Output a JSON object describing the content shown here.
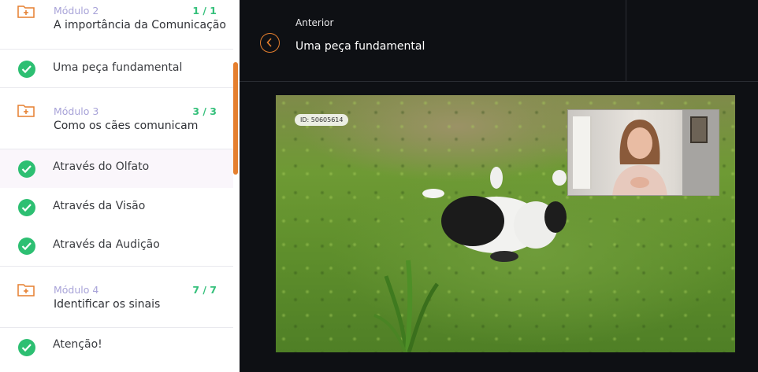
{
  "sidebar": {
    "modules": [
      {
        "label": "Módulo 2",
        "count": "1 / 1",
        "title": "A importância da Comunicação"
      },
      {
        "label": "Módulo 3",
        "count": "3 / 3",
        "title": "Como os cães comunicam"
      },
      {
        "label": "Módulo 4",
        "count": "7 / 7",
        "title": "Identificar os sinais"
      }
    ],
    "lessons": [
      {
        "label": "Uma peça fundamental"
      },
      {
        "label": "Através do Olfato"
      },
      {
        "label": "Através da Visão"
      },
      {
        "label": "Através da Audição"
      },
      {
        "label": "Atenção!"
      }
    ]
  },
  "header": {
    "prev_label": "Anterior",
    "prev_title": "Uma peça fundamental"
  },
  "video": {
    "id_tag": "ID: 50605614"
  },
  "colors": {
    "accent": "#e57f2e",
    "success": "#2dbf72",
    "module_label": "#a8a3d8",
    "background": "#0e1014"
  }
}
